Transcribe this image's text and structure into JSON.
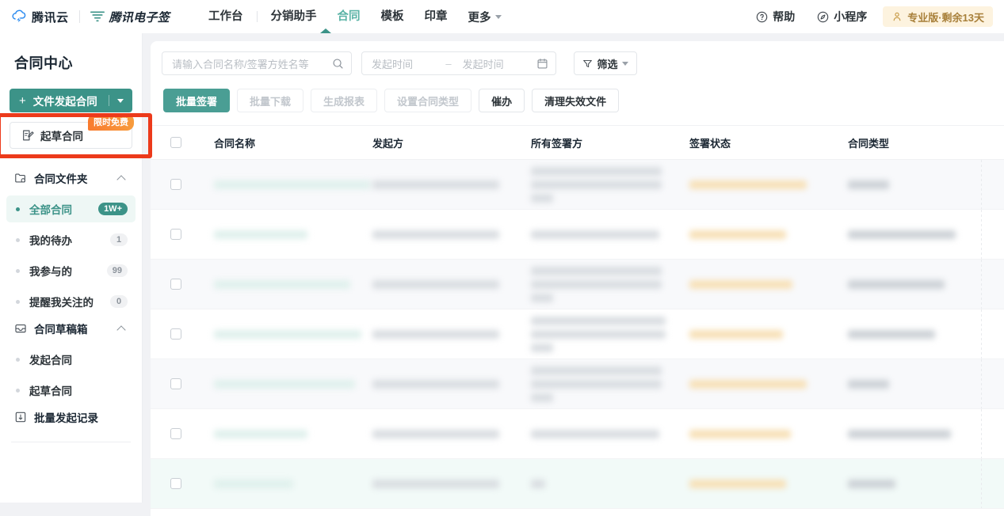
{
  "topnav": {
    "brand_cloud": "腾讯云",
    "brand_esign": "腾讯电子签",
    "cloud_icon": "cloud-icon",
    "esign_icon": "esign-logo-icon",
    "items": [
      {
        "label": "工作台",
        "active": false
      },
      {
        "label": "分销助手",
        "active": false
      },
      {
        "label": "合同",
        "active": true
      },
      {
        "label": "模板",
        "active": false
      },
      {
        "label": "印章",
        "active": false
      }
    ],
    "more_label": "更多",
    "help_label": "帮助",
    "help_icon": "question-circle-icon",
    "miniapp_label": "小程序",
    "miniapp_icon": "compass-icon",
    "pro_badge": "专业版·剩余13天",
    "pro_icon": "user-crown-icon",
    "accent": "#3c9388",
    "pro_badge_bg": "#fdf3df",
    "pro_badge_color": "#a8803a"
  },
  "sidebar": {
    "title": "合同中心",
    "primary_button": {
      "label": "文件发起合同",
      "plus": "+",
      "caret_icon": "caret-down-icon"
    },
    "draft_button": {
      "label": "起草合同",
      "icon": "draft-contract-icon",
      "tag": "限时免费"
    },
    "highlight_color": "#ec3a1b",
    "groups": [
      {
        "label": "合同文件夹",
        "icon": "folder-contract-icon",
        "collapse_icon": "chevron-up-icon",
        "items": [
          {
            "label": "全部合同",
            "badge": "1W+",
            "badge_style": "teal",
            "active": true
          },
          {
            "label": "我的待办",
            "badge": "1",
            "badge_style": "gray",
            "active": false
          },
          {
            "label": "我参与的",
            "badge": "99",
            "badge_style": "gray",
            "active": false
          },
          {
            "label": "提醒我关注的",
            "badge": "0",
            "badge_style": "gray",
            "active": false
          }
        ]
      },
      {
        "label": "合同草稿箱",
        "icon": "drawer-icon",
        "collapse_icon": "chevron-up-icon",
        "items": [
          {
            "label": "发起合同",
            "badge": "",
            "badge_style": "none",
            "active": false
          },
          {
            "label": "起草合同",
            "badge": "",
            "badge_style": "none",
            "active": false
          }
        ]
      }
    ],
    "batch_record": {
      "label": "批量发起记录",
      "icon": "batch-record-icon"
    }
  },
  "main": {
    "search": {
      "placeholder": "请输入合同名称/签署方姓名等",
      "value": "",
      "icon": "search-icon"
    },
    "date_range": {
      "start_placeholder": "发起时间",
      "end_placeholder": "发起时间",
      "separator": "–",
      "icon": "calendar-icon"
    },
    "filter_button": {
      "label": "筛选",
      "icon": "filter-icon",
      "caret_icon": "caret-down-icon"
    },
    "actions": [
      {
        "label": "批量签署",
        "state": "primary"
      },
      {
        "label": "批量下载",
        "state": "disabled"
      },
      {
        "label": "生成报表",
        "state": "disabled"
      },
      {
        "label": "设置合同类型",
        "state": "disabled"
      },
      {
        "label": "催办",
        "state": "normal"
      },
      {
        "label": "清理失效文件",
        "state": "normal"
      }
    ],
    "table": {
      "select_all_icon": "checkbox-unchecked-icon",
      "columns": [
        "合同名称",
        "发起方",
        "所有签署方",
        "签署状态",
        "合同类型"
      ],
      "rows": [
        {
          "redacted": true,
          "stripe": true,
          "signers_lines": 3,
          "name_w": 198,
          "from_w": 160,
          "signer_w": [
            165,
            165,
            28
          ],
          "status_w": 148,
          "type_w": 52
        },
        {
          "redacted": true,
          "stripe": false,
          "signers_lines": 1,
          "name_w": 118,
          "from_w": 160,
          "signer_w": [
            162
          ],
          "status_w": 122,
          "type_w": 136
        },
        {
          "redacted": true,
          "stripe": true,
          "signers_lines": 3,
          "name_w": 172,
          "from_w": 160,
          "signer_w": [
            165,
            165,
            28
          ],
          "status_w": 130,
          "type_w": 122
        },
        {
          "redacted": true,
          "stripe": false,
          "signers_lines": 3,
          "name_w": 186,
          "from_w": 160,
          "signer_w": [
            170,
            170,
            28
          ],
          "status_w": 118,
          "type_w": 110
        },
        {
          "redacted": true,
          "stripe": true,
          "signers_lines": 3,
          "name_w": 178,
          "from_w": 160,
          "signer_w": [
            165,
            165,
            28
          ],
          "status_w": 148,
          "type_w": 52
        },
        {
          "redacted": true,
          "stripe": false,
          "signers_lines": 1,
          "name_w": 118,
          "from_w": 160,
          "signer_w": [
            162
          ],
          "status_w": 128,
          "type_w": 130
        },
        {
          "redacted": true,
          "stripe": false,
          "signers_lines": 1,
          "name_w": 100,
          "from_w": 160,
          "signer_w": [
            18
          ],
          "status_w": 122,
          "type_w": 60,
          "mint": true
        }
      ]
    }
  }
}
